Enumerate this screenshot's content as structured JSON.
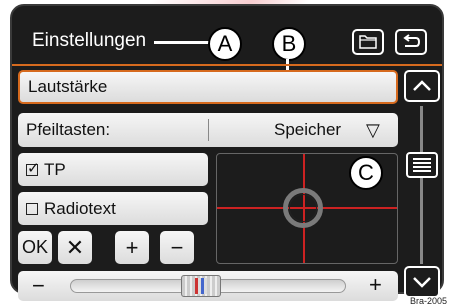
{
  "header": {
    "title": "Einstellungen"
  },
  "callouts": {
    "a": "A",
    "b": "B",
    "c": "C"
  },
  "main": {
    "volume_label": "Lautstärke",
    "arrow_keys_label": "Pfeiltasten:",
    "arrow_keys_value": "Speicher",
    "arrow_keys_dropdown_icon": "▽",
    "tp_label": "TP",
    "tp_checked": true,
    "radiotext_label": "Radiotext",
    "radiotext_checked": false,
    "ok_label": "OK",
    "cancel_icon": "✕",
    "plus_icon": "+",
    "minus_icon": "−"
  },
  "slider": {
    "minus": "−",
    "plus": "+",
    "level": 0.47
  },
  "scrollbar": {
    "position": 0.35
  },
  "image_code": "Bra-2005",
  "icons": [
    "folder-icon",
    "back-arrow-icon",
    "chevron-up-icon",
    "chevron-down-icon",
    "scroll-grip-icon",
    "crosshair-icon"
  ],
  "colors": {
    "accent": "#d66a1e",
    "crosshair": "#cc2222",
    "background": "#1c1c1c"
  }
}
